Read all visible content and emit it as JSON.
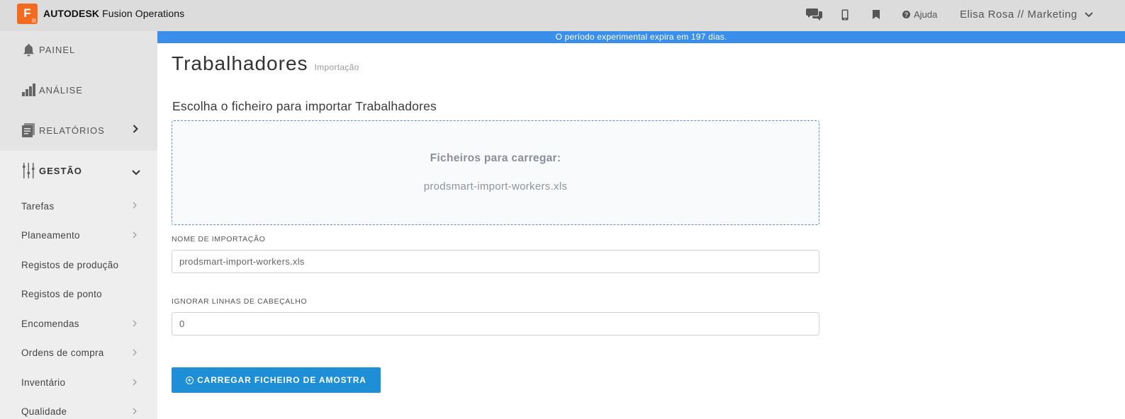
{
  "app": {
    "brand_bold": "AUTODESK",
    "brand_name": "Fusion Operations",
    "logo_letter": "F",
    "logo_color": "#f36b21"
  },
  "header": {
    "icons": [
      "chat-icon",
      "mobile-icon",
      "bookmark-icon"
    ],
    "help_label": "Ajuda",
    "user_label": "Elisa Rosa // Marketing"
  },
  "banner": {
    "text": "O período experimental expira em 197 dias.",
    "color": "#3a8fea"
  },
  "sidebar": {
    "main_items": [
      {
        "label": "PAINEL",
        "icon": "bell-icon"
      },
      {
        "label": "ANÁLISE",
        "icon": "bar-chart-icon"
      },
      {
        "label": "RELATÓRIOS",
        "icon": "reports-icon",
        "arrow": "›"
      },
      {
        "label": "GESTÃO",
        "icon": "sliders-icon",
        "arrow": "⌄",
        "active": true
      }
    ],
    "sub_items": [
      {
        "label": "Tarefas",
        "has_arrow": true
      },
      {
        "label": "Planeamento",
        "has_arrow": true
      },
      {
        "label": "Registos de produção",
        "has_arrow": false
      },
      {
        "label": "Registos de ponto",
        "has_arrow": false
      },
      {
        "label": "Encomendas",
        "has_arrow": true
      },
      {
        "label": "Ordens de compra",
        "has_arrow": true
      },
      {
        "label": "Inventário",
        "has_arrow": true
      },
      {
        "label": "Qualidade",
        "has_arrow": true
      }
    ]
  },
  "page": {
    "title": "Trabalhadores",
    "subtitle": "Importação",
    "section_heading": "Escolha o ficheiro para importar Trabalhadores"
  },
  "dropzone": {
    "title": "Ficheiros para carregar:",
    "file": "prodsmart-import-workers.xls"
  },
  "form": {
    "import_name_label": "NOME DE IMPORTAÇÃO",
    "import_name_value": "prodsmart-import-workers.xls",
    "skip_header_label": "IGNORAR LINHAS DE CABEÇALHO",
    "skip_header_value": "0"
  },
  "actions": {
    "upload_sample_label": "CARREGAR FICHEIRO DE AMOSTRA",
    "button_color": "#1e8fd6"
  }
}
